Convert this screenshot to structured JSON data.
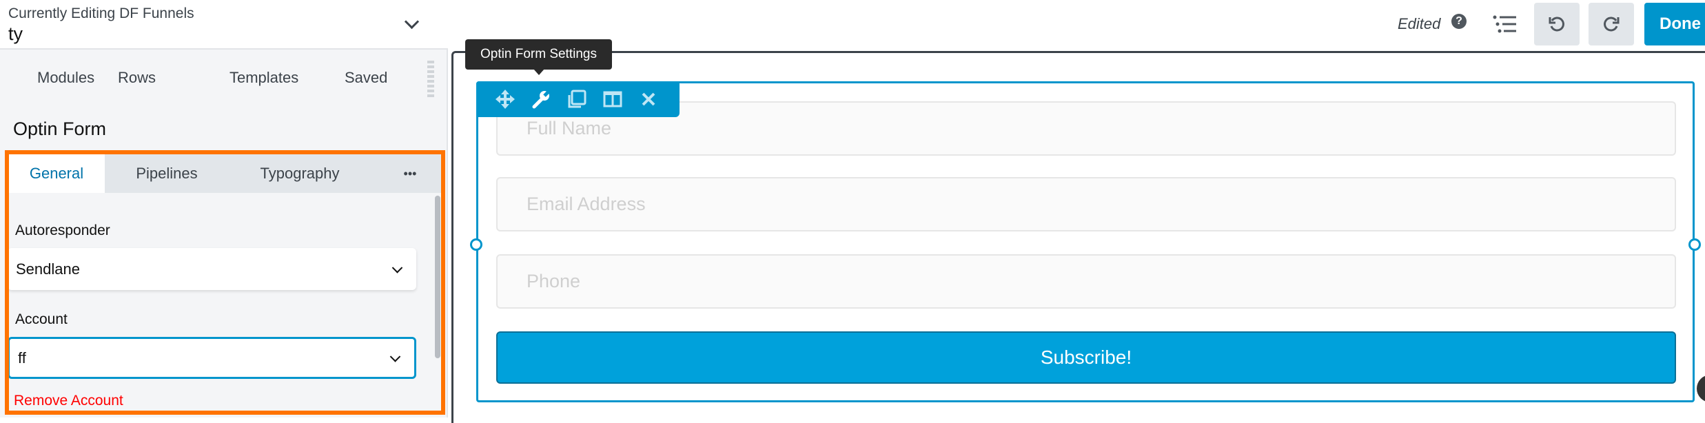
{
  "header": {
    "editing_label": "Currently Editing DF Funnels",
    "page_name": "ty"
  },
  "nav_tabs": [
    "Modules",
    "Rows",
    "Templates",
    "Saved"
  ],
  "module_title": "Optin Form",
  "settings_tabs": {
    "general": "General",
    "pipelines": "Pipelines",
    "typography": "Typography",
    "more": "•••"
  },
  "fields": {
    "autoresponder_label": "Autoresponder",
    "autoresponder_value": "Sendlane",
    "account_label": "Account",
    "account_value": "ff",
    "remove_account": "Remove Account"
  },
  "topbar": {
    "status": "Edited",
    "done": "Done"
  },
  "tooltip": "Optin Form Settings",
  "form": {
    "full_name": "Full Name",
    "email": "Email Address",
    "phone": "Phone",
    "submit": "Subscribe!"
  },
  "colors": {
    "accent": "#0095cc",
    "highlight": "#ff7300",
    "danger": "#ff0000",
    "button": "#00a1db"
  }
}
